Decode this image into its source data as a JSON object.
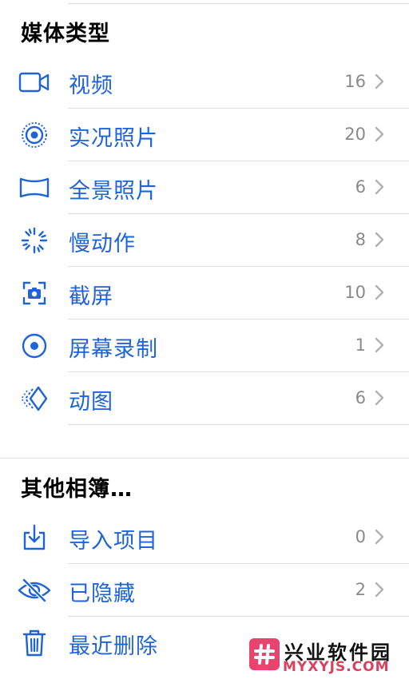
{
  "media_types": {
    "title": "媒体类型",
    "items": [
      {
        "label": "视频",
        "count": "16",
        "icon": "video-icon"
      },
      {
        "label": "实况照片",
        "count": "20",
        "icon": "live-photo-icon"
      },
      {
        "label": "全景照片",
        "count": "6",
        "icon": "panorama-icon"
      },
      {
        "label": "慢动作",
        "count": "8",
        "icon": "slow-motion-icon"
      },
      {
        "label": "截屏",
        "count": "10",
        "icon": "screenshot-icon"
      },
      {
        "label": "屏幕录制",
        "count": "1",
        "icon": "screen-recording-icon"
      },
      {
        "label": "动图",
        "count": "6",
        "icon": "animated-icon"
      }
    ]
  },
  "other_albums": {
    "title": "其他相簿…",
    "items": [
      {
        "label": "导入项目",
        "count": "0",
        "icon": "import-icon"
      },
      {
        "label": "已隐藏",
        "count": "2",
        "icon": "hidden-eye-icon"
      },
      {
        "label": "最近删除",
        "count": "",
        "icon": "trash-icon"
      }
    ]
  },
  "watermark": {
    "name": "兴业软件园",
    "url": "MYXYJS.COM"
  },
  "colors": {
    "accent": "#1f63d9",
    "count_gray": "#8a8a8e",
    "separator": "#e0e0e3"
  }
}
